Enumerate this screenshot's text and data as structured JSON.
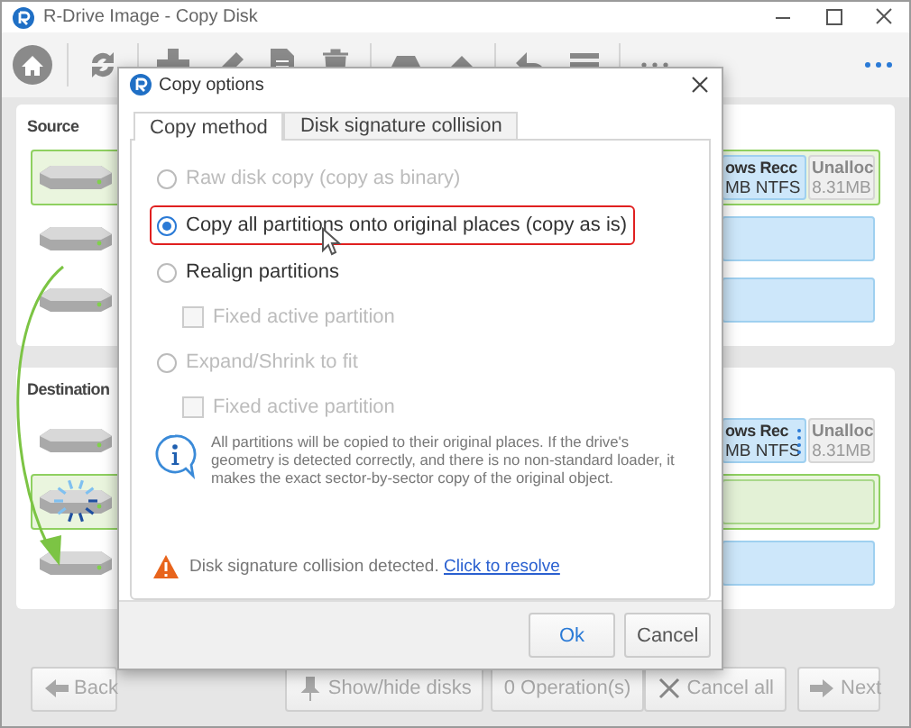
{
  "window": {
    "title": "R-Drive Image - Copy Disk"
  },
  "source": {
    "label": "Source",
    "disks": [
      {
        "selected": true,
        "busy": false,
        "partitions": [
          {
            "kind": "partition",
            "name": "ows Recc",
            "detail": "MB NTFS"
          },
          {
            "kind": "unallocated",
            "name": "Unalloc",
            "detail": "8.31MB"
          }
        ]
      },
      {
        "selected": false,
        "busy": false,
        "partitions": [
          {
            "kind": "bar"
          }
        ]
      },
      {
        "selected": false,
        "busy": false,
        "partitions": [
          {
            "kind": "bar"
          }
        ]
      }
    ]
  },
  "destination": {
    "label": "Destination",
    "disks": [
      {
        "selected": false,
        "busy": false,
        "partitions": [
          {
            "kind": "partition",
            "name": "ows Rec",
            "detail": "MB NTFS",
            "handle": true
          },
          {
            "kind": "unallocated",
            "name": "Unalloc",
            "detail": "8.31MB"
          }
        ]
      },
      {
        "selected": true,
        "busy": true,
        "partitions": [
          {
            "kind": "free"
          }
        ]
      },
      {
        "selected": false,
        "busy": false,
        "partitions": [
          {
            "kind": "bar"
          }
        ]
      }
    ]
  },
  "dialog": {
    "title": "Copy options",
    "tabs": [
      {
        "label": "Copy method",
        "selected": true
      },
      {
        "label": "Disk signature collision",
        "selected": false
      }
    ],
    "options": [
      {
        "kind": "radio",
        "label": "Raw disk copy (copy as binary)",
        "selected": false,
        "disabled": true,
        "highlighted": false
      },
      {
        "kind": "radio",
        "label": "Copy all partitions onto original places (copy as is)",
        "selected": true,
        "disabled": false,
        "highlighted": true
      },
      {
        "kind": "radio",
        "label": "Realign partitions",
        "selected": false,
        "disabled": false,
        "highlighted": false,
        "children": [
          {
            "kind": "checkbox",
            "label": "Fixed active partition",
            "checked": false,
            "disabled": true
          }
        ]
      },
      {
        "kind": "radio",
        "label": "Expand/Shrink to fit",
        "selected": false,
        "disabled": true,
        "highlighted": false,
        "children": [
          {
            "kind": "checkbox",
            "label": "Fixed active partition",
            "checked": false,
            "disabled": true
          }
        ]
      }
    ],
    "info": "All partitions will be copied to their original places. If the drive's geometry is detected correctly, and there is no non-standard loader, it makes the exact sector-by-sector copy of the original object.",
    "warning": {
      "text": "Disk signature collision detected.",
      "link": "Click to resolve"
    },
    "buttons": [
      {
        "label": "Ok",
        "default": true
      },
      {
        "label": "Cancel",
        "default": false
      }
    ]
  },
  "bottom_bar": {
    "buttons": [
      {
        "kind": "back",
        "label": "Back",
        "disabled": true
      },
      {
        "kind": "show",
        "label": "Show/hide disks",
        "disabled": true
      },
      {
        "kind": "operations",
        "label": "0 Operation(s)",
        "disabled": true
      },
      {
        "kind": "cancel",
        "label": "Cancel all",
        "disabled": true
      },
      {
        "kind": "next",
        "label": "Next",
        "disabled": true
      }
    ]
  }
}
